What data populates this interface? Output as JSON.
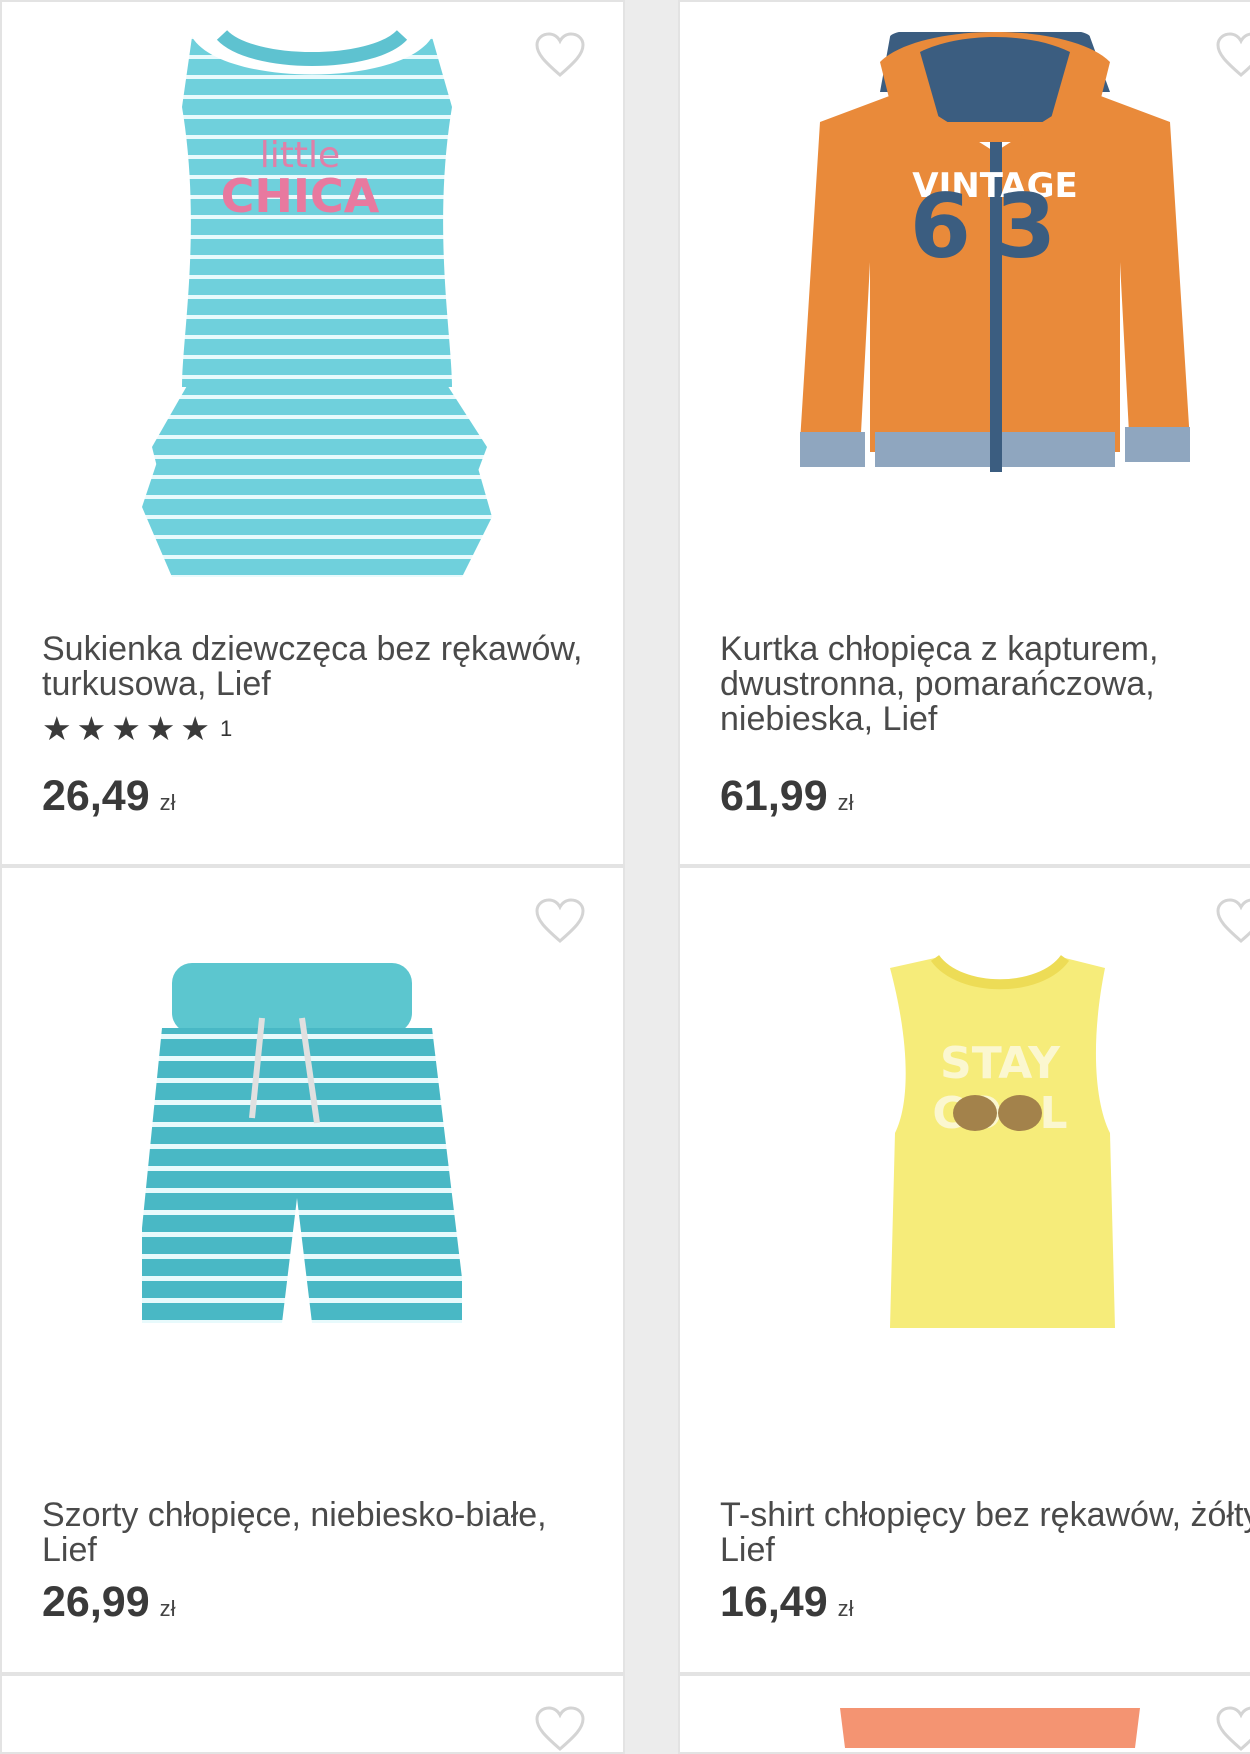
{
  "products": [
    {
      "title": "Sukienka dziewczęca bez rękawów, turkusowa, Lief",
      "rating_count": "1",
      "price": "26,49",
      "currency": "zł",
      "image_text_1": "little",
      "image_text_2": "CHICA"
    },
    {
      "title": "Kurtka chłopięca z kapturem, dwustronna, pomarańczowa, niebieska, Lief",
      "price": "61,99",
      "currency": "zł",
      "image_text_1": "VINTAGE",
      "image_text_2": "63"
    },
    {
      "title": "Szorty chłopięce, niebiesko-białe, Lief",
      "price": "26,99",
      "currency": "zł"
    },
    {
      "title": "T-shirt chłopięcy bez rękawów, żółty, Lief",
      "price": "16,49",
      "currency": "zł",
      "image_text_1": "STAY",
      "image_text_2": "COOL"
    }
  ],
  "icons": {
    "favorite": "heart-outline-icon",
    "star": "star-icon"
  },
  "colors": {
    "turquoise": "#6fd0dc",
    "orange": "#e98a3a",
    "navy": "#3b5d80",
    "yellow": "#f6ec7a",
    "text": "#4a4a4a"
  }
}
